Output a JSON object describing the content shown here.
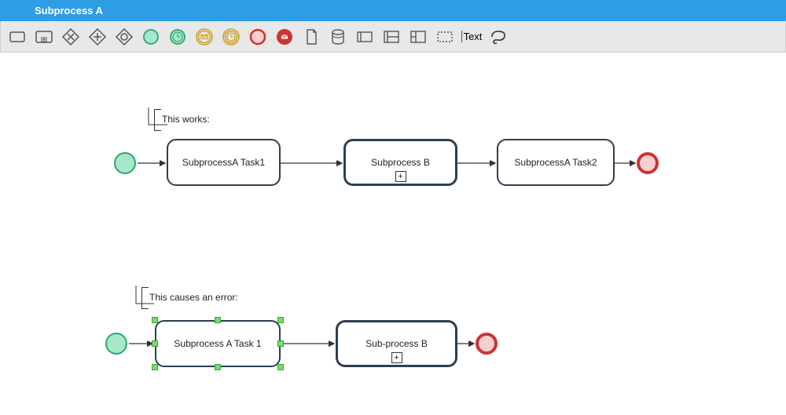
{
  "title": "Subprocess A",
  "toolbar": [
    {
      "name": "task-tool",
      "icon": "rect"
    },
    {
      "name": "subprocess-tool",
      "icon": "rect-plus"
    },
    {
      "name": "gateway-exclusive-tool",
      "icon": "diamond-x"
    },
    {
      "name": "gateway-parallel-tool",
      "icon": "diamond-plus"
    },
    {
      "name": "gateway-inclusive-tool",
      "icon": "diamond-o"
    },
    {
      "name": "start-event-tool",
      "icon": "circle-green"
    },
    {
      "name": "timer-event-tool",
      "icon": "circle-clock"
    },
    {
      "name": "intermediate-message-tool",
      "icon": "ring-mail-gold"
    },
    {
      "name": "intermediate-timer-tool",
      "icon": "ring-clock-gold"
    },
    {
      "name": "end-event-tool",
      "icon": "circle-red"
    },
    {
      "name": "message-end-tool",
      "icon": "circle-mail-red"
    },
    {
      "name": "document-tool",
      "icon": "doc"
    },
    {
      "name": "datastore-tool",
      "icon": "cylinder"
    },
    {
      "name": "pool-tool",
      "icon": "pool-one"
    },
    {
      "name": "lane-tool",
      "icon": "pool-two"
    },
    {
      "name": "lane3-tool",
      "icon": "pool-header"
    },
    {
      "name": "group-tool",
      "icon": "dashed-rect"
    },
    {
      "name": "text-tool",
      "icon": "text",
      "label": "Text"
    },
    {
      "name": "lasso-tool",
      "icon": "lasso"
    }
  ],
  "diagram1": {
    "annotation": "This works:",
    "start": true,
    "task1": {
      "label": "SubprocessA Task1"
    },
    "subprocess": {
      "label": "Subprocess B"
    },
    "task2": {
      "label": "SubprocessA Task2"
    },
    "end": true
  },
  "diagram2": {
    "annotation": "This causes an error:",
    "start": true,
    "task1": {
      "label": "Subprocess A Task 1",
      "selected": true
    },
    "subprocess": {
      "label": "Sub-process B"
    },
    "end": true
  },
  "colors": {
    "accent": "#2e9de5",
    "start_fill": "#a6e8c9",
    "start_stroke": "#29a86f",
    "end_fill": "#f8cfcf",
    "end_stroke": "#cc3333",
    "node_stroke": "#2d3e50"
  }
}
